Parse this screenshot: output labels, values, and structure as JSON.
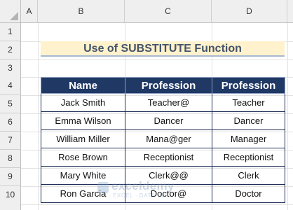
{
  "columns": [
    "A",
    "B",
    "C",
    "D"
  ],
  "rows": [
    "1",
    "2",
    "3",
    "4",
    "5",
    "6",
    "7",
    "8",
    "9",
    "10"
  ],
  "title": "Use of SUBSTITUTE Function",
  "table": {
    "headers": [
      "Name",
      "Profession",
      "Profession"
    ],
    "rows": [
      [
        "Jack Smith",
        "Teacher@",
        "Teacher"
      ],
      [
        "Emma Wilson",
        "Dancer",
        "Dancer"
      ],
      [
        "William Miller",
        "Mana@ger",
        "Manager"
      ],
      [
        "Rose Brown",
        "Receptionist",
        "Receptionist"
      ],
      [
        "Mary White",
        "Clerk@@",
        "Clerk"
      ],
      [
        "Ron Garcia",
        "Doctor@",
        "Doctor"
      ]
    ]
  },
  "watermark": {
    "brand": "exceldemy",
    "sub": "EXCEL · DATA · BI"
  },
  "colors": {
    "header_bg": "#203864",
    "title_bg": "#fff2cc",
    "title_text": "#44546a"
  }
}
